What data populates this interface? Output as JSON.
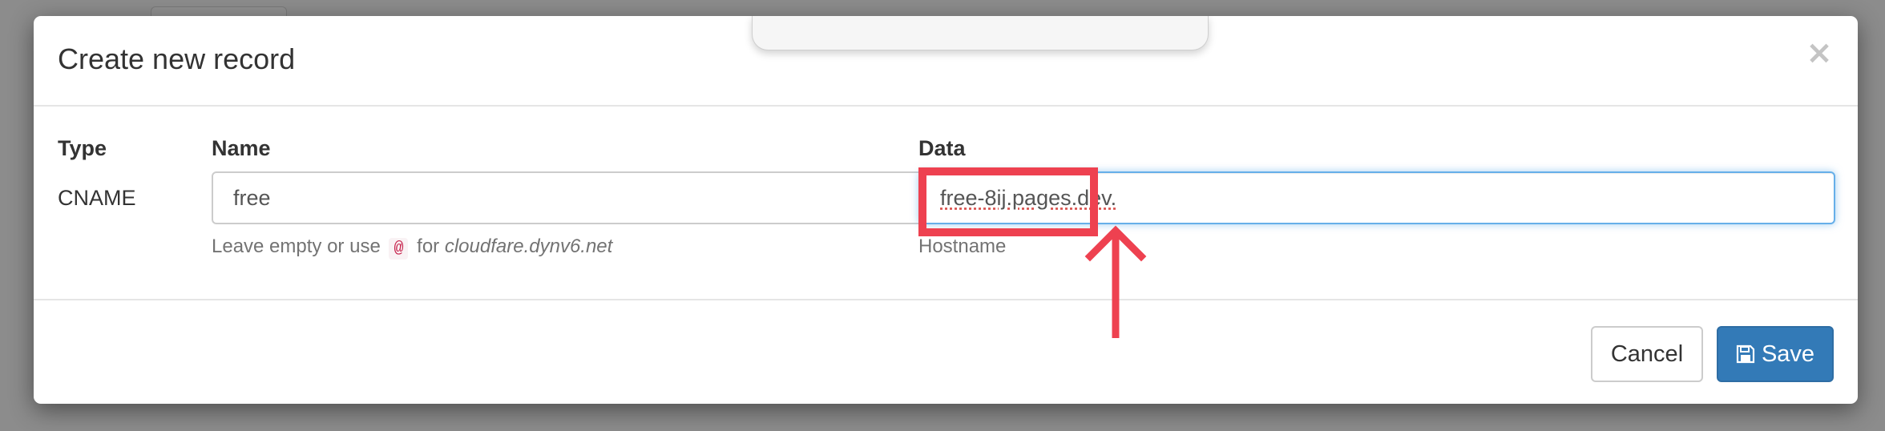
{
  "modal": {
    "title": "Create new record",
    "close_label": "×"
  },
  "form": {
    "type": {
      "label": "Type",
      "value": "CNAME"
    },
    "name": {
      "label": "Name",
      "value": "free",
      "help_prefix": "Leave empty or use",
      "help_code": "@",
      "help_middle": "for",
      "help_domain": "cloudfare.dynv6.net"
    },
    "data": {
      "label": "Data",
      "value": "free-8ij.pages.dev.",
      "help": "Hostname"
    }
  },
  "footer": {
    "cancel_label": "Cancel",
    "save_label": "Save",
    "save_color": "#337ab7"
  },
  "annotation": {
    "color": "#ee4150",
    "icon": "arrow-up-icon"
  }
}
